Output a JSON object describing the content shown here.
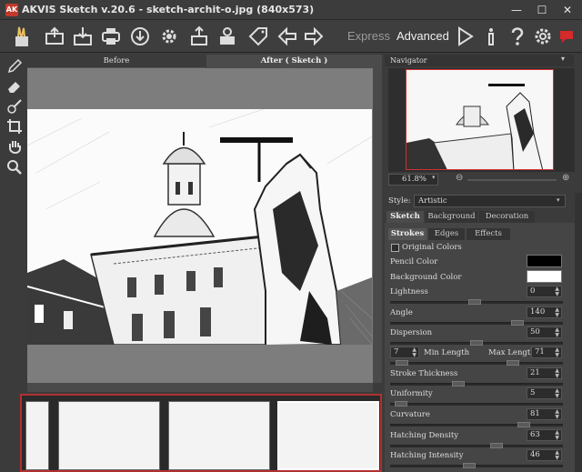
{
  "window": {
    "title": "AKVIS Sketch v.20.6 - sketch-archit-o.jpg (840x573)",
    "logo_text": "AK",
    "minimize": "—",
    "maximize": "☐",
    "close": "✕"
  },
  "toolbar": {
    "icons": [
      "brush-logo-icon",
      "open-file-icon",
      "save-file-icon",
      "print-icon",
      "share-icon",
      "settings-gear-icon",
      "batch-icon",
      "plugin-icon",
      "tag-icon",
      "undo-arrow-icon",
      "redo-arrow-icon"
    ],
    "mode_express": "Express",
    "mode_advanced": "Advanced",
    "right_icons": [
      "run-icon",
      "info-icon",
      "help-icon",
      "preferences-icon",
      "notification-icon"
    ],
    "accent_color": "#c0392b"
  },
  "view_tabs": {
    "before": "Before",
    "after": "After ( Sketch )"
  },
  "left_tools": [
    "pencil-icon",
    "eraser-icon",
    "history-brush-icon",
    "crop-icon",
    "hand-icon",
    "zoom-icon"
  ],
  "navigator": {
    "title": "Navigator",
    "zoom": "61.8%"
  },
  "style": {
    "label": "Style:",
    "value": "Artistic"
  },
  "panel_tabs": [
    "Sketch",
    "Background",
    "Decoration"
  ],
  "sub_tabs": [
    "Strokes",
    "Edges",
    "Effects"
  ],
  "params": {
    "original_colors": "Original Colors",
    "pencil_color": "Pencil Color",
    "background_color": "Background Color",
    "lightness_label": "Lightness",
    "lightness": "0",
    "angle_label": "Angle",
    "angle": "140",
    "dispersion_label": "Dispersion",
    "dispersion": "50",
    "min_length": "7",
    "min_length_label": "Min Length",
    "max_length_label": "Max Length",
    "max_length": "71",
    "stroke_thickness_label": "Stroke Thickness",
    "stroke_thickness": "21",
    "uniformity_label": "Uniformity",
    "uniformity": "5",
    "curvature_label": "Curvature",
    "curvature": "81",
    "hatching_density_label": "Hatching Density",
    "hatching_density": "63",
    "hatching_intensity_label": "Hatching Intensity",
    "hatching_intensity": "46",
    "pencil_color_hex": "#000000",
    "background_color_hex": "#ffffff"
  }
}
